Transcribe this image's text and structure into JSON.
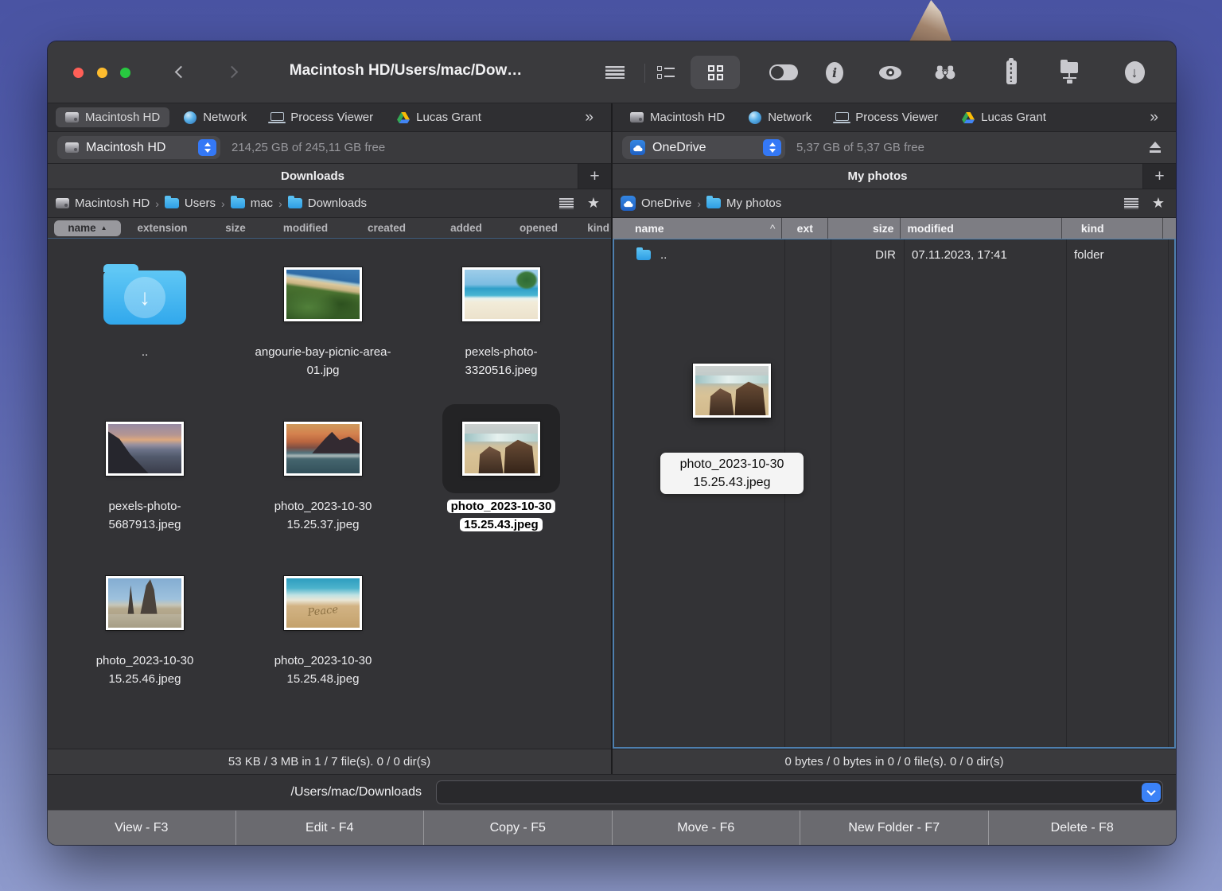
{
  "window": {
    "title": "Macintosh HD/Users/mac/Dow…",
    "toolbar_icons": [
      "menu",
      "list-view",
      "grid-view",
      "toggle",
      "info",
      "preview-eye",
      "search-binoculars",
      "archive-zip",
      "network-share",
      "download"
    ]
  },
  "left_pane": {
    "tabs": [
      {
        "label": "Macintosh HD",
        "icon": "hard-drive",
        "selected": true
      },
      {
        "label": "Network",
        "icon": "globe",
        "selected": false
      },
      {
        "label": "Process Viewer",
        "icon": "laptop",
        "selected": false
      },
      {
        "label": "Lucas Grant",
        "icon": "google-drive",
        "selected": false
      }
    ],
    "more_tabs": "»",
    "drive_selector": {
      "label": "Macintosh HD",
      "icon": "hard-drive"
    },
    "free_space": "214,25 GB of 245,11 GB free",
    "folder_tab": "Downloads",
    "new_tab": "+",
    "breadcrumb": [
      {
        "label": "Macintosh HD",
        "icon": "hard-drive"
      },
      {
        "label": "Users",
        "icon": "folder"
      },
      {
        "label": "mac",
        "icon": "folder"
      },
      {
        "label": "Downloads",
        "icon": "folder"
      }
    ],
    "columns": [
      "name",
      "extension",
      "size",
      "modified",
      "created",
      "added",
      "opened",
      "kind"
    ],
    "sort_indicator": "▲",
    "items": [
      {
        "name": "..",
        "type": "parent-folder"
      },
      {
        "name": "angourie-bay-picnic-area-01.jpg",
        "type": "image"
      },
      {
        "name": "pexels-photo-3320516.jpeg",
        "type": "image"
      },
      {
        "name": "pexels-photo-5687913.jpeg",
        "type": "image"
      },
      {
        "name": "photo_2023-10-30 15.25.37.jpeg",
        "type": "image"
      },
      {
        "name": "photo_2023-10-30 15.25.43.jpeg",
        "type": "image",
        "selected": true
      },
      {
        "name": "photo_2023-10-30 15.25.46.jpeg",
        "type": "image"
      },
      {
        "name": "photo_2023-10-30 15.25.48.jpeg",
        "type": "image"
      }
    ],
    "status": "53 KB / 3 MB in 1 / 7 file(s). 0 / 0 dir(s)"
  },
  "right_pane": {
    "tabs": [
      {
        "label": "Macintosh HD",
        "icon": "hard-drive",
        "selected": false
      },
      {
        "label": "Network",
        "icon": "globe",
        "selected": false
      },
      {
        "label": "Process Viewer",
        "icon": "laptop",
        "selected": false
      },
      {
        "label": "Lucas Grant",
        "icon": "google-drive",
        "selected": false
      }
    ],
    "more_tabs": "»",
    "drive_selector": {
      "label": "OneDrive",
      "icon": "onedrive"
    },
    "free_space": "5,37 GB of 5,37 GB free",
    "folder_tab": "My photos",
    "new_tab": "+",
    "breadcrumb": [
      {
        "label": "OneDrive",
        "icon": "onedrive"
      },
      {
        "label": "My photos",
        "icon": "folder"
      }
    ],
    "columns": [
      "name",
      "ext",
      "size",
      "modified",
      "kind"
    ],
    "sort_indicator": "^",
    "rows": [
      {
        "name": "..",
        "ext": "",
        "size": "DIR",
        "modified": "07.11.2023, 17:41",
        "kind": "folder"
      }
    ],
    "drag_item": {
      "name": "photo_2023-10-30 15.25.43.jpeg"
    },
    "status": "0 bytes / 0 bytes in 0 / 0 file(s). 0 / 0 dir(s)"
  },
  "path_bar": {
    "label": "/Users/mac/Downloads",
    "input_value": ""
  },
  "function_bar": {
    "buttons": [
      "View - F3",
      "Edit - F4",
      "Copy - F5",
      "Move - F6",
      "New Folder - F7",
      "Delete - F8"
    ]
  }
}
